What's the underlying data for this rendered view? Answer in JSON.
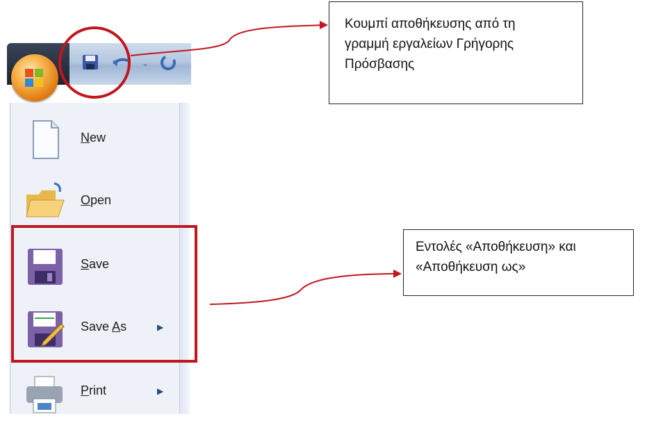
{
  "quick_access": {
    "buttons": [
      "office-button",
      "save-button",
      "undo-button",
      "dropdown",
      "redo-button"
    ]
  },
  "menu": {
    "items": [
      {
        "label_pre": "",
        "label_ul": "N",
        "label_post": "ew",
        "icon": "new-document-icon",
        "submenu": false
      },
      {
        "label_pre": "",
        "label_ul": "O",
        "label_post": "pen",
        "icon": "open-folder-icon",
        "submenu": false
      },
      {
        "label_pre": "",
        "label_ul": "S",
        "label_post": "ave",
        "icon": "save-floppy-icon",
        "submenu": false
      },
      {
        "label_pre": "Save ",
        "label_ul": "A",
        "label_post": "s",
        "icon": "save-as-icon",
        "submenu": true
      },
      {
        "label_pre": "",
        "label_ul": "P",
        "label_post": "rint",
        "icon": "printer-icon",
        "submenu": true
      }
    ]
  },
  "callouts": {
    "qat_text": "Κουμπί αποθήκευσης από τη γραμμή εργαλείων Γρήγορης Πρόσβασης",
    "qat_line1": "Κουμπί αποθήκευσης από τη",
    "qat_line2": "γραμμή εργαλείων Γρήγορης",
    "qat_line3": "Πρόσβασης",
    "save_line1": "Εντολές «Αποθήκευση» και",
    "save_line2": "«Αποθήκευση ως»"
  },
  "colors": {
    "highlight": "#c0161d",
    "menu_bg": "#eef2f8"
  }
}
